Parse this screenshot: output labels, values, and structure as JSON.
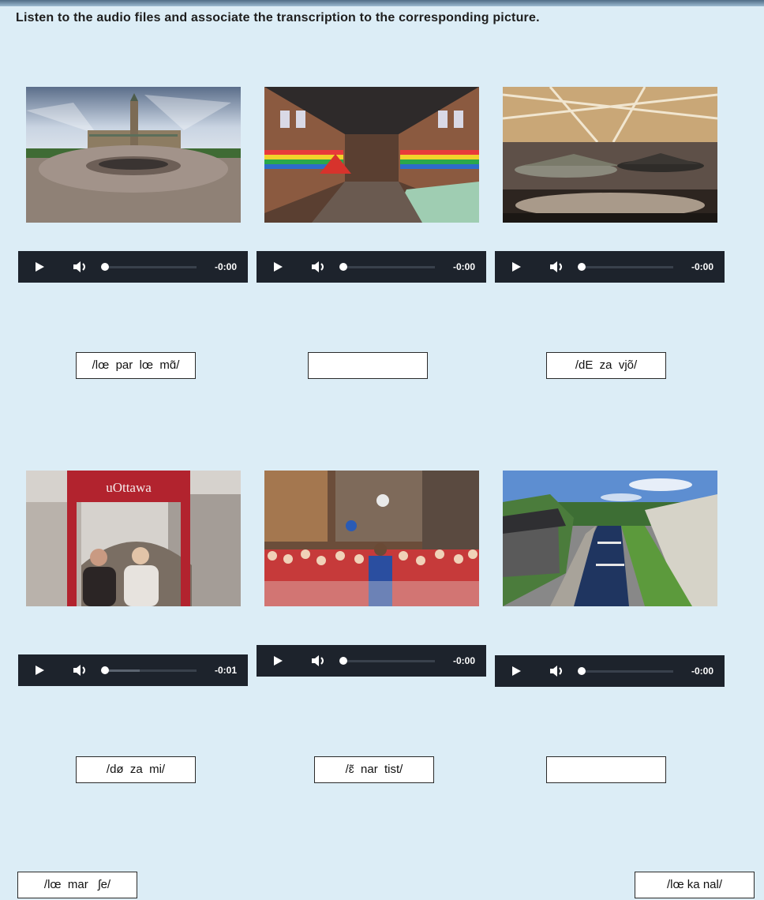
{
  "instruction": "Listen to the audio files and associate the transcription to the corresponding picture.",
  "items": [
    {
      "photo_icon": "parliament-photo",
      "time": "-0:00",
      "progress": 0,
      "buffered": 0,
      "answer": "/lœ  par  lœ  mɑ̃/"
    },
    {
      "photo_icon": "market-hall-photo",
      "time": "-0:00",
      "progress": 0,
      "buffered": 0,
      "answer": ""
    },
    {
      "photo_icon": "aircraft-museum-photo",
      "time": "-0:00",
      "progress": 0,
      "buffered": 0,
      "answer": "/dE  za  vjõ/"
    },
    {
      "photo_icon": "uottawa-sign-photo",
      "time": "-0:01",
      "progress": 0,
      "buffered": 0.38,
      "answer": "/dø  za  mi/"
    },
    {
      "photo_icon": "street-performer-crowd-photo",
      "time": "-0:00",
      "progress": 0,
      "buffered": 0,
      "answer": "/ɛ̃  nar  tist/"
    },
    {
      "photo_icon": "canal-locks-photo",
      "time": "-0:00",
      "progress": 0,
      "buffered": 0,
      "answer": ""
    }
  ],
  "bank": [
    {
      "label": "/lœ  mar   ʃe/"
    },
    {
      "label": "/lœ ka nal/"
    }
  ],
  "icons": {
    "play": "play-icon",
    "volume": "volume-icon"
  },
  "colors": {
    "background": "#dcedf6",
    "player": "#1d232c",
    "box_border": "#2a2a2a"
  }
}
